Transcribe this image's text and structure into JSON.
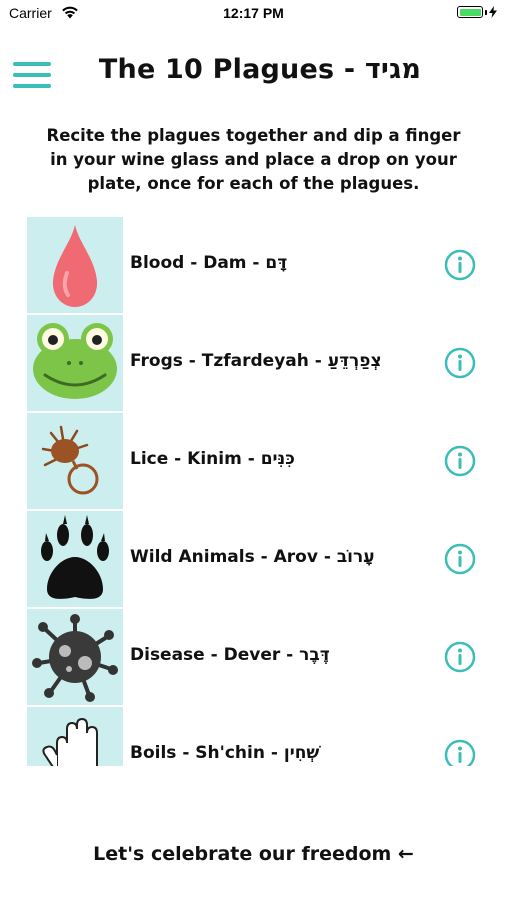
{
  "status_bar": {
    "carrier": "Carrier",
    "time": "12:17 PM"
  },
  "header": {
    "title": "The 10 Plagues - מגיד"
  },
  "intro": "Recite the plagues together and dip a finger in your wine glass and place a drop on your plate, once for each of the plagues.",
  "plagues": [
    {
      "label": "Blood - Dam - דָּם",
      "icon": "blood-drop-icon"
    },
    {
      "label": "Frogs - Tzfardeyah - צְפַרְדֵּעַ",
      "icon": "frog-icon"
    },
    {
      "label": "Lice - Kinim - כִּנִּים",
      "icon": "lice-icon"
    },
    {
      "label": "Wild Animals - Arov - עָרוֹב",
      "icon": "paw-print-icon"
    },
    {
      "label": "Disease - Dever - דֶּבֶר",
      "icon": "virus-icon"
    },
    {
      "label": "Boils - Sh'chin - שְׁחִין",
      "icon": "hand-boils-icon"
    }
  ],
  "footer": {
    "cta": "Let's celebrate our freedom ←"
  },
  "colors": {
    "accent": "#3bbdb8",
    "thumb_bg": "#cdeeee"
  }
}
